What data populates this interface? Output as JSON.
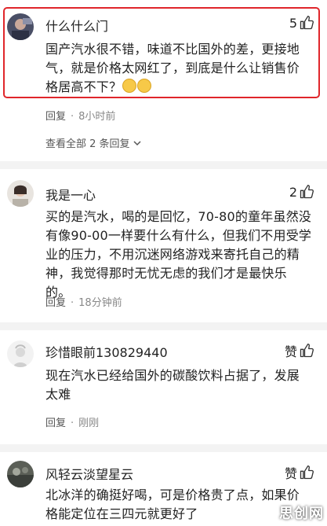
{
  "comments": [
    {
      "username": "什么什么门",
      "likes": "5",
      "text": "国产汽水很不错，味道不比国外的差，更接地气，就是价格太网红了，到底是什么让销售价格居高不下？",
      "reply_label": "回复",
      "time": "8小时前",
      "highlighted": true
    },
    {
      "username": "我是一心",
      "likes": "2",
      "text": "买的是汽水，喝的是回忆，70-80的童年虽然没有像90-00一样要什么有什么，但我们不用受学业的压力，不用沉迷网络游戏来寄托自己的精神，我觉得那时无忧无虑的我们才是最快乐的。",
      "reply_label": "回复",
      "time": "18分钟前"
    },
    {
      "username": "珍惜眼前130829440",
      "likes": "赞",
      "text": "现在汽水已经给国外的碳酸饮料占据了，发展太难",
      "reply_label": "回复",
      "time": "刚刚"
    },
    {
      "username": "风轻云淡望星云",
      "likes": "赞",
      "text": "北冰洋的确挺好喝，可是价格贵了点，如果价格能定位在三四元就更好了"
    }
  ],
  "view_all_replies": "查看全部 2 条回复",
  "watermark": "思创网",
  "colors": {
    "highlight": "#e0262b",
    "meta": "#888888",
    "divider": "#f3f3f3"
  }
}
